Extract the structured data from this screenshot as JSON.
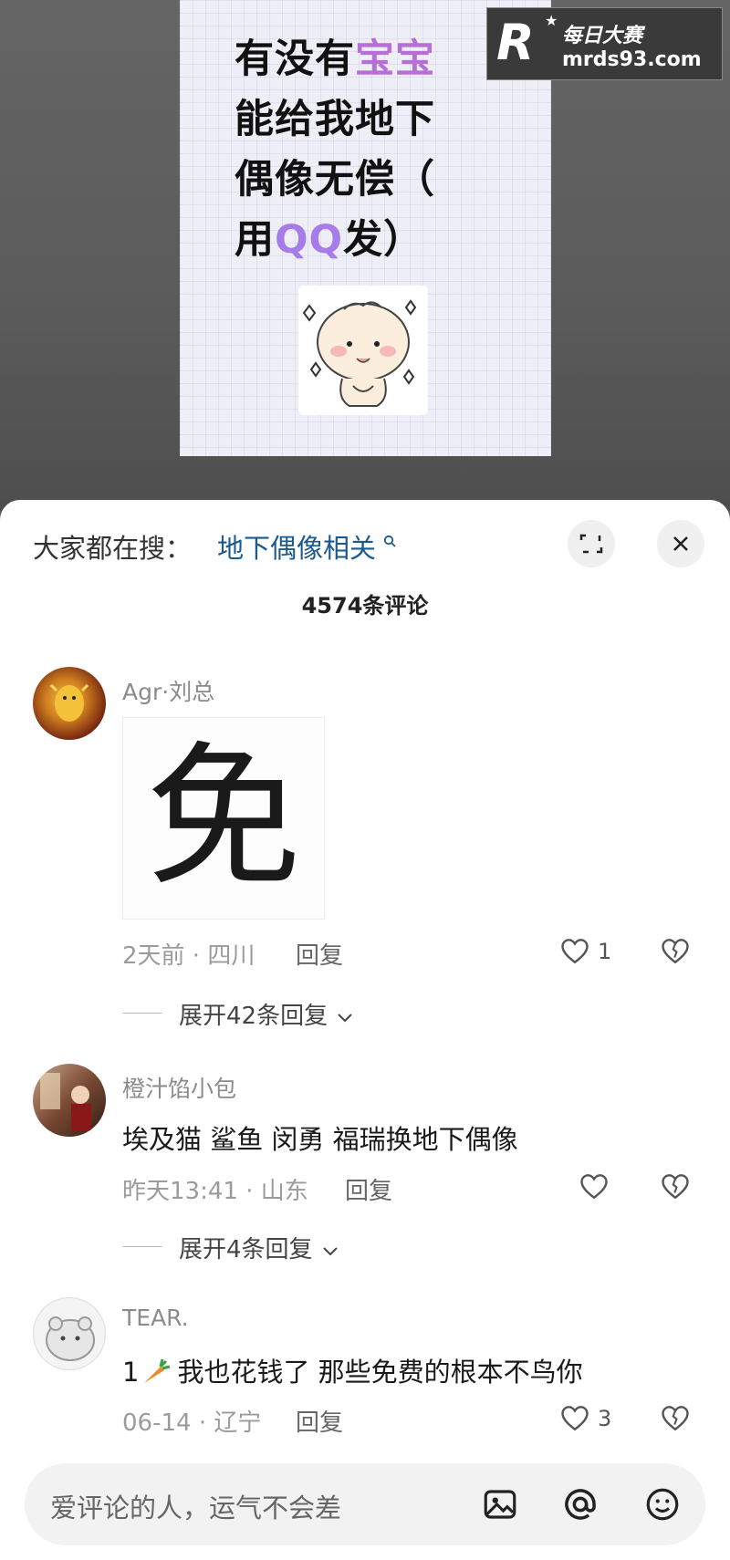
{
  "poster": {
    "line1_a": "有没有",
    "line1_b": "宝宝",
    "line2": "能给我地下",
    "line3": "偶像无偿（",
    "line4_a": "用",
    "line4_b": "QQ",
    "line4_c": "发）"
  },
  "watermark": {
    "logo": "R",
    "name": "每日大赛",
    "url": "mrds93.com"
  },
  "search": {
    "prefix": "大家都在搜：",
    "link": "地下偶像相关"
  },
  "comments_header": {
    "count_title": "4574条评论"
  },
  "comments": [
    {
      "user": "Agr·刘总",
      "image_text": "免",
      "meta": "2天前 · 四川",
      "reply_label": "回复",
      "likes": "1",
      "expand": "展开42条回复"
    },
    {
      "user": "橙汁馅小包",
      "text": "埃及猫 鲨鱼 闵勇 福瑞换地下偶像",
      "meta": "昨天13:41 · 山东",
      "reply_label": "回复",
      "likes": "",
      "expand": "展开4条回复"
    },
    {
      "user": "TEAR.",
      "text_prefix": "1",
      "text": "我也花钱了 那些免费的根本不鸟你",
      "meta": "06-14 · 辽宁",
      "reply_label": "回复",
      "likes": "3"
    }
  ],
  "input": {
    "placeholder": "爱评论的人，运气不会差"
  },
  "colors": {
    "link": "#1a5a8e",
    "poster_highlight": "#b56fd6",
    "sheet_bg": "#ffffff"
  },
  "icons": [
    "search-icon",
    "expand-icon",
    "close-icon",
    "heart-icon",
    "broken-heart-icon",
    "chevron-down-icon",
    "image-icon",
    "at-icon",
    "emoji-icon",
    "carrot-icon"
  ]
}
